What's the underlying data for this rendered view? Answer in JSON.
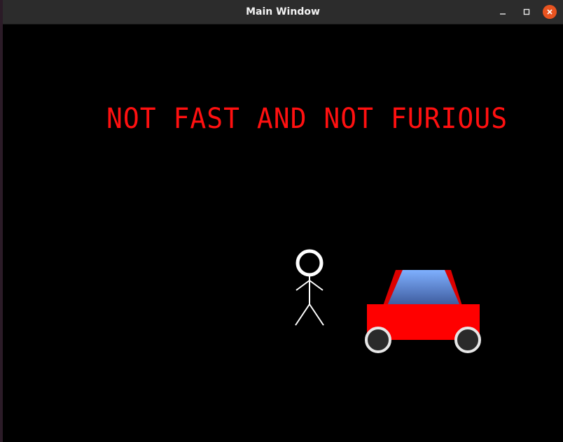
{
  "window": {
    "title": "Main Window"
  },
  "titlebar_buttons": {
    "minimize_icon": "minimize-icon",
    "maximize_icon": "maximize-icon",
    "close_icon": "close-icon"
  },
  "scene": {
    "headline": "NOT FAST AND NOT FURIOUS",
    "colors": {
      "background": "#000000",
      "headline": "#ff1010",
      "stick_figure": "#ffffff",
      "car_body": "#ff0000",
      "car_window_top": "#7fb0ff",
      "car_window_bottom": "#3d5a9c",
      "wheel": "#2a2a2a",
      "wheel_rim": "#e6e6e6"
    }
  }
}
